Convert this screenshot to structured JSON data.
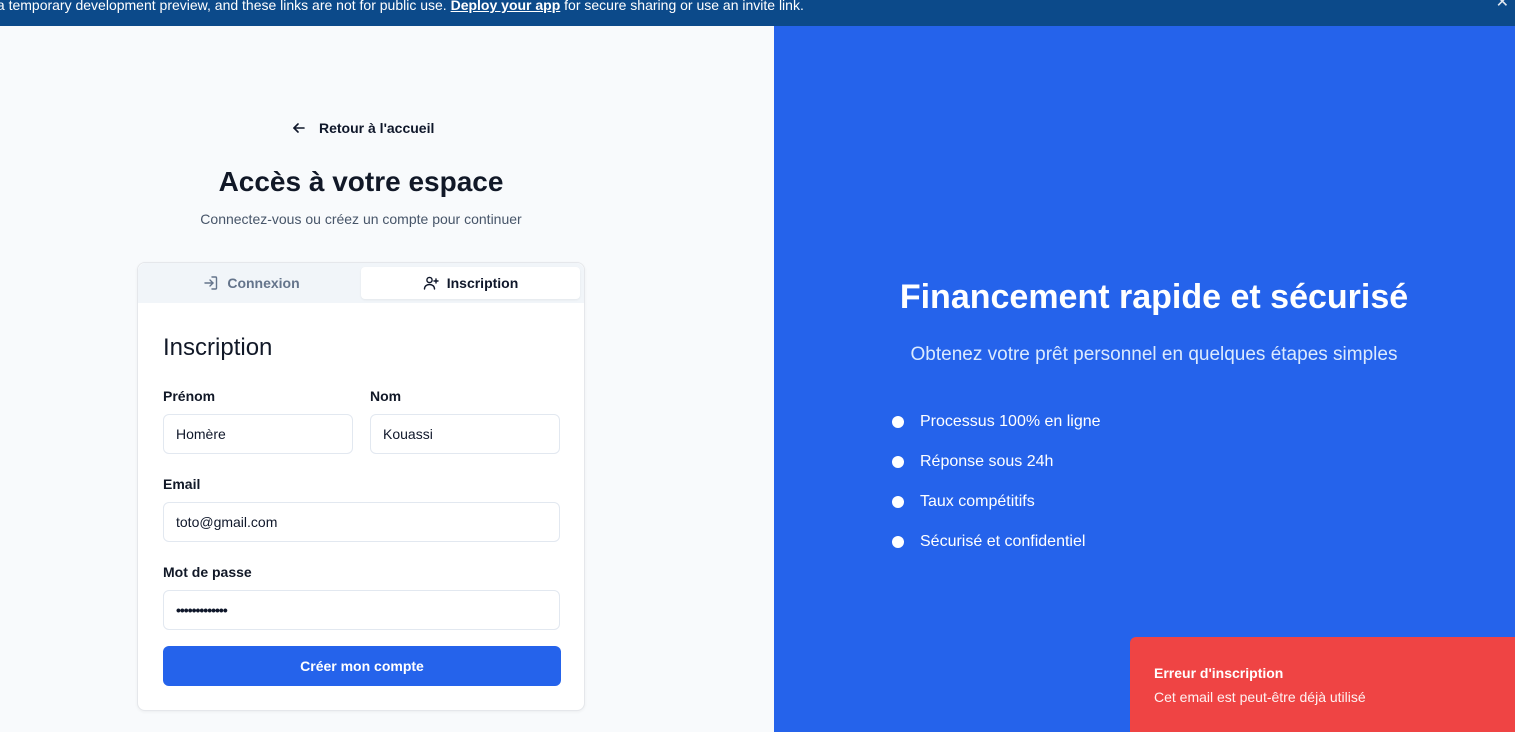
{
  "banner": {
    "text_before": "s a temporary development preview, and these links are not for public use. ",
    "link": "Deploy your app",
    "text_after": " for secure sharing or use an invite link.",
    "close_icon": "close-icon"
  },
  "left": {
    "back_link": "Retour à l'accueil",
    "title": "Accès à votre espace",
    "subtitle": "Connectez-vous ou créez un compte pour continuer",
    "tabs": [
      {
        "label": "Connexion",
        "icon": "login-icon",
        "active": false
      },
      {
        "label": "Inscription",
        "icon": "user-plus-icon",
        "active": true
      }
    ],
    "form": {
      "title": "Inscription",
      "first_name_label": "Prénom",
      "first_name_value": "Homère",
      "last_name_label": "Nom",
      "last_name_value": "Kouassi",
      "email_label": "Email",
      "email_value": "toto@gmail.com",
      "password_label": "Mot de passe",
      "password_value": "•••••••••••••",
      "submit_label": "Créer mon compte"
    }
  },
  "right": {
    "title": "Financement rapide et sécurisé",
    "subtitle": "Obtenez votre prêt personnel en quelques étapes simples",
    "features": [
      "Processus 100% en ligne",
      "Réponse sous 24h",
      "Taux compétitifs",
      "Sécurisé et confidentiel"
    ]
  },
  "toast": {
    "title": "Erreur d'inscription",
    "message": "Cet email est peut-être déjà utilisé"
  },
  "colors": {
    "banner": "#0c4a8a",
    "primary": "#2563eb",
    "error": "#ef4444"
  }
}
